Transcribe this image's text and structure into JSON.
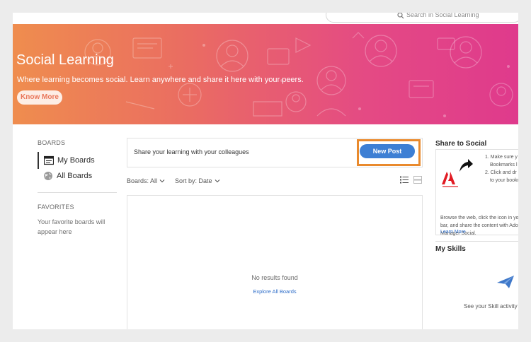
{
  "search": {
    "placeholder": "Search in Social Learning"
  },
  "hero": {
    "title": "Social Learning",
    "subtitle": "Where learning becomes social. Learn anywhere and share it here with your peers.",
    "button": "Know More"
  },
  "sidebar": {
    "boards_heading": "BOARDS",
    "items": [
      {
        "label": "My Boards",
        "icon": "boards-icon",
        "active": true
      },
      {
        "label": "All Boards",
        "icon": "globe-icon",
        "active": false
      }
    ],
    "favorites_heading": "FAVORITES",
    "favorites_empty": "Your favorite boards will appear here"
  },
  "main": {
    "share_prompt": "Share your learning with your colleagues",
    "new_post": "New Post",
    "filters": {
      "boards": "Boards: All",
      "sort": "Sort by: Date"
    },
    "empty_title": "No results found",
    "explore_link": "Explore All Boards"
  },
  "right": {
    "share_heading": "Share to Social",
    "steps": [
      "1. Make sure y",
      "Bookmarks l",
      "2. Click and dr",
      "to your bookm"
    ],
    "browse_lines": [
      "Browse the web, click the icon in yo",
      "bar, and share the content with Ado",
      "Manager Social."
    ],
    "learn_more": "Learn More",
    "skills_heading": "My Skills",
    "skills_empty": "See your Skill activity"
  },
  "colors": {
    "accent": "#3d7fd4",
    "highlight": "#e98a2d",
    "hero_start": "#ef8d4e",
    "hero_end": "#df3a8c",
    "link": "#2f6ec9"
  }
}
